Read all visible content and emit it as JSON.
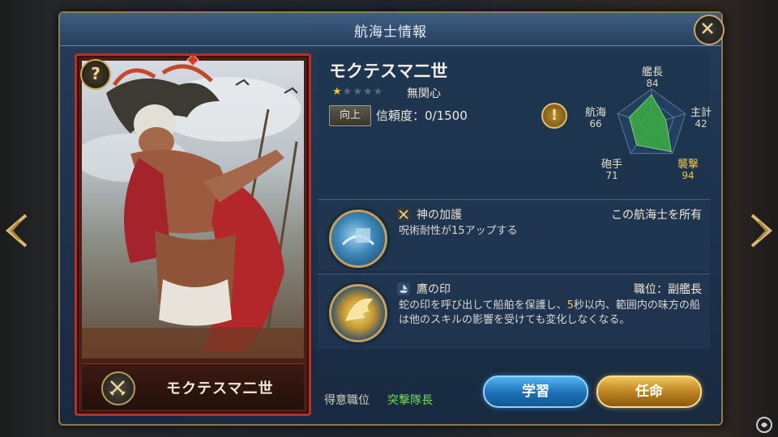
{
  "window": {
    "title": "航海士情報"
  },
  "card": {
    "help_glyph": "?",
    "name": "モクテスマ二世",
    "role_icon": "crossed-swords-icon"
  },
  "profile": {
    "name": "モクテスマ二世",
    "stars_filled": 1,
    "stars_total": 5,
    "attitude": "無関心",
    "upgrade_label": "向上",
    "trust_label": "信頼度：0/1500",
    "alert_glyph": "!"
  },
  "stats": {
    "command": {
      "label": "艦長",
      "value": 84
    },
    "leadership": {
      "label": "主計",
      "value": 42
    },
    "assault": {
      "label": "襲撃",
      "value": 94
    },
    "gunner": {
      "label": "砲手",
      "value": 71
    },
    "navigation": {
      "label": "航海",
      "value": 66
    },
    "max": 100,
    "fill_color": "#3aa845",
    "highlight_color": "#f0c74c"
  },
  "skills": [
    {
      "name": "神の加護",
      "requirement": "この航海士を所有",
      "description": "呪術耐性が15アップする",
      "icon": "crossed-swords-icon"
    },
    {
      "name": "鷹の印",
      "requirement": "職位：副艦長",
      "description_parts": [
        "蛇の印を呼び出して船舶を保護し、",
        "5",
        "秒以内、範囲内の味方の船は他のスキルの影響を受けても変化しなくなる。"
      ],
      "icon": "ship-icon"
    }
  ],
  "footer": {
    "specialty_label": "得意職位",
    "specialty_value": "突撃隊長",
    "learn_label": "学習",
    "appoint_label": "任命"
  },
  "colors": {
    "learn_button": "#1e6fb6",
    "appoint_button": "#b8801e",
    "card_border": "#b23226",
    "specialty_text": "#6fdc54"
  }
}
